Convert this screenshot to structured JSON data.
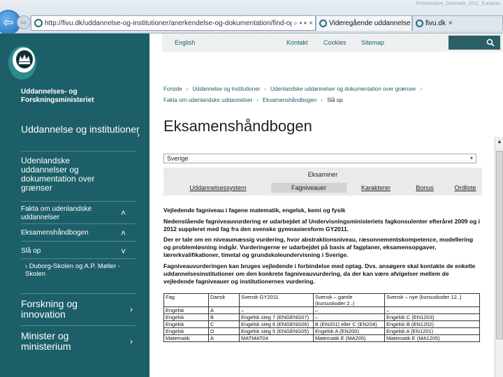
{
  "browser": {
    "url": "http://fivu.dk/uddannelse-og-institutioner/anerkendelse-og-dokumentation/find-op",
    "address_controls": "⌕ ▾ ▸ ×",
    "tabs": [
      {
        "label": "Videregående uddannelse · Op...",
        "close": "×"
      },
      {
        "label": "fivu.dk",
        "close": "×"
      }
    ],
    "back_glyph": "⇦",
    "forward_glyph": "⇨",
    "corner_text": "Presentation_Denmark_2011_Europan"
  },
  "sidebar": {
    "ministry": [
      "Uddannelses- og",
      "Forskningsministeriet"
    ],
    "nav": [
      {
        "label": "Uddannelse og institutioner",
        "arrow": "›"
      },
      {
        "label": "Udenlandske uddannelser og dokumentation over grænser"
      },
      {
        "label": "Fakta om udenlandske uddannelser",
        "arrow": "˄"
      },
      {
        "label": "Eksamenshåndbogen",
        "arrow": "˄"
      },
      {
        "label": "Slå op",
        "arrow": "˅"
      },
      {
        "label": "Duborg-Skolen og A.P. Møller -Skolen",
        "bullet": "›"
      },
      {
        "label": "Forskning og innovation",
        "arrow": "›"
      },
      {
        "label": "Minister og ministerium",
        "arrow": "›"
      }
    ]
  },
  "topbar": {
    "english": "English",
    "contact": "Kontakt",
    "cookies": "Cookies",
    "sitemap": "Sitemap"
  },
  "breadcrumb": {
    "items": [
      "Forside",
      "Uddannelse og institutioner",
      "Udenlandske uddannelser og dokumentation over grænser",
      "Fakta om udenlandske uddannelser",
      "Eksamenshåndbogen",
      "Slå op"
    ],
    "separator": "›"
  },
  "page": {
    "title": "Eksamenshåndbogen",
    "country": "Sverige",
    "dropdown_glyph": "▾",
    "tabs_heading": "Eksaminer",
    "tabs": [
      "Uddannelsessystem",
      "Fagniveauer",
      "Karakterer",
      "Bonus",
      "Ordliste"
    ],
    "heading": "Vejledende fagniveau i fagene matematik, engelsk, kemi og fysik",
    "intro": "Nedenstående fagniveauvurdering er udarbejdet af Undervisningsministeriets fagkonsulenter efteråret 2009 og i 2012 suppleret med fag fra den svenske gymnasiereform GY2011.",
    "para2": "Der er tale om en niveaumæssig vurdering, hvor abstraktionsniveau, ræsonnementskompetence, modellering og problemløsning indgår. Vurderingerne er udarbejdet på basis af fagplaner, eksamensopgaver, lærerkvalifikationer, timetal og grundskoleundervisning i Sverige.",
    "para3": "Fagniveauvurderingen kan bruges vejledende i forbindelse med optag. Dvs. ansøgere skal kontakte de enkelte uddannelsesinstitutioner om den konkrete fagniveauvurdering, da der kan være afvigelser mellem de vejledende fagniveauer og institutionernes vurdering."
  },
  "table": {
    "headers": [
      "Fag",
      "Dansk",
      "Svensk GY2011",
      "Svensk – gamle (kursuskoder 2..)",
      "Svensk – nye (kursuskoder 12..)"
    ],
    "rows": [
      [
        "Engelsk",
        "A",
        "–",
        "–",
        "–"
      ],
      [
        "Engelsk",
        "B",
        "Engelsk steg 7 (ENGENG07)",
        "–",
        "Engelsk C (EN1203)"
      ],
      [
        "Engelsk",
        "C",
        "Engelsk steg 6 (ENGENG06)",
        "B (EN201) eller C (EN204)",
        "Engelsk B (EN1202)"
      ],
      [
        "Engelsk",
        "D",
        "Engelsk steg 5 (ENGENG05)",
        "Engelsk A (EN200)",
        "Engelsk A (EN1201)"
      ],
      [
        "Matematik",
        "A",
        "MATMAT04",
        "Matematik E (MA205)",
        "Matematik E (MA1205)"
      ]
    ]
  },
  "colors": {
    "sidebar": "#1d5f68",
    "topbar": "#edf0ef",
    "search": "#2b5f66",
    "link": "#1d5f68"
  }
}
